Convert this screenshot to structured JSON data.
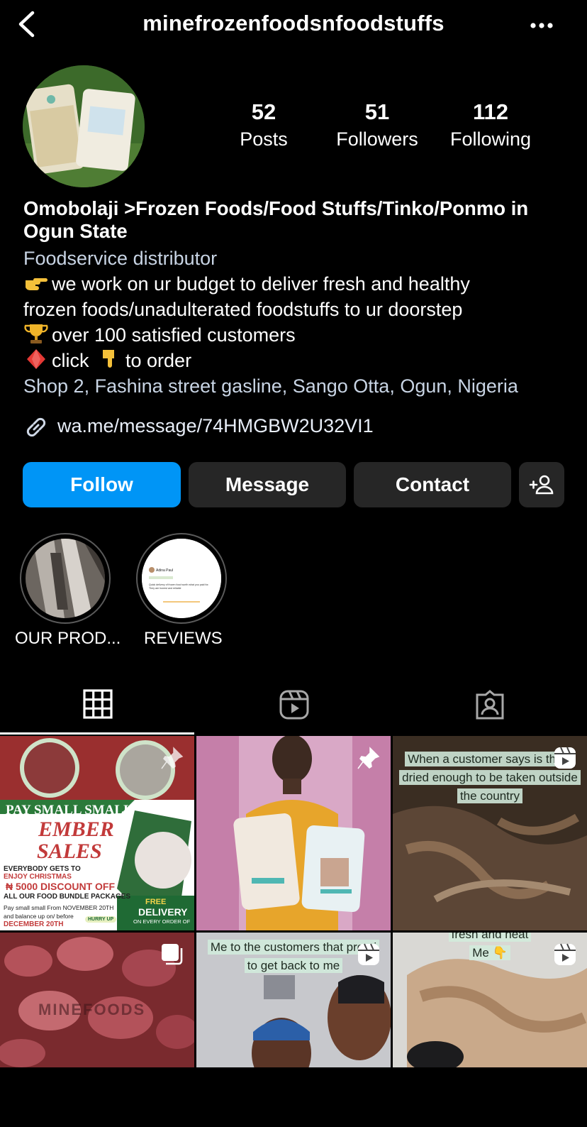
{
  "header": {
    "username": "minefrozenfoodsnfoodstuffs"
  },
  "stats": {
    "posts": {
      "value": "52",
      "label": "Posts"
    },
    "followers": {
      "value": "51",
      "label": "Followers"
    },
    "following": {
      "value": "112",
      "label": "Following"
    }
  },
  "bio": {
    "name": "Omobolaji >Frozen Foods/Food Stuffs/Tinko/Ponmo in Ogun State",
    "category": "Foodservice distributor",
    "line1": "we work on ur budget to deliver fresh and healthy",
    "line2": "frozen foods/unadulterated foodstuffs to ur doorstep",
    "line3": "over 100 satisfied customers",
    "line4a": "click",
    "line4b": "to order",
    "address": "Shop 2, Fashina street gasline, Sango Otta, Ogun, Nigeria",
    "link": "wa.me/message/74HMGBW2U32VI1"
  },
  "actions": {
    "follow": "Follow",
    "message": "Message",
    "contact": "Contact"
  },
  "highlights": [
    {
      "label": "OUR PROD..."
    },
    {
      "label": "REVIEWS"
    }
  ],
  "posts": [
    {
      "banner": "PAY SMALL SMALL",
      "title1": "EMBER",
      "title2": "SALES",
      "line1": "EVERYBODY GETS TO",
      "line2": "ENJOY CHRISTMAS",
      "discount": "₦ 5000 DISCOUNT OFF",
      "bundle": "ALL OUR FOOD BUNDLE PACKAGES",
      "small1": "Pay small small From NOVEMBER 20TH",
      "small2": "and balance up on/ before",
      "small3": "DECEMBER 20TH",
      "free": "FREE",
      "delivery": "DELIVERY",
      "order": "ON EVERY ORDER OF",
      "hurry": "HURRY UP"
    },
    {},
    {
      "caption1": "When a customer says is the fi",
      "caption2": "dried enough to be taken outside",
      "caption3": "the country"
    },
    {
      "watermark": "MINEFOODS"
    },
    {
      "caption1": "Me to the customers that promi",
      "caption2": "to get back to me"
    },
    {
      "caption0": "fresh and neat",
      "caption1": "Me 👇"
    }
  ],
  "review_card": {
    "name": "Adina Paul",
    "text": "Quick delivery of frozen food worth what you paid for. They are honest and reliable"
  }
}
